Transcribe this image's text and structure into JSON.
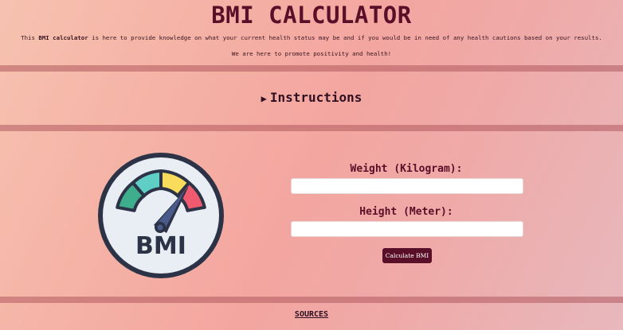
{
  "header": {
    "title": "BMI CALCULATOR",
    "desc_prefix": "This ",
    "desc_bold": "BMI calculator",
    "desc_suffix": " is here to provide knowledge on what your current health status may be and if you would be in need of any health cautions based on your results.",
    "tagline": "We are here to promote positivity and health!"
  },
  "instructions": {
    "arrow": "▶",
    "label": "Instructions"
  },
  "gauge": {
    "text": "BMI",
    "icon": "bmi-gauge-icon",
    "colors": {
      "teal": "#5fcfc5",
      "yellow": "#f9dc5c",
      "red": "#f05a6e",
      "green": "#3fae8d",
      "outline": "#2c3347",
      "face": "#e8eef3"
    }
  },
  "form": {
    "weight_label": "Weight (Kilogram):",
    "weight_value": "",
    "height_label": "Height (Meter):",
    "height_value": "",
    "calculate_label": "Calculate BMI"
  },
  "footer": {
    "sources_label": "SOURCES"
  },
  "colors": {
    "primary": "#5a0f28",
    "divider": "#b05a5f"
  }
}
